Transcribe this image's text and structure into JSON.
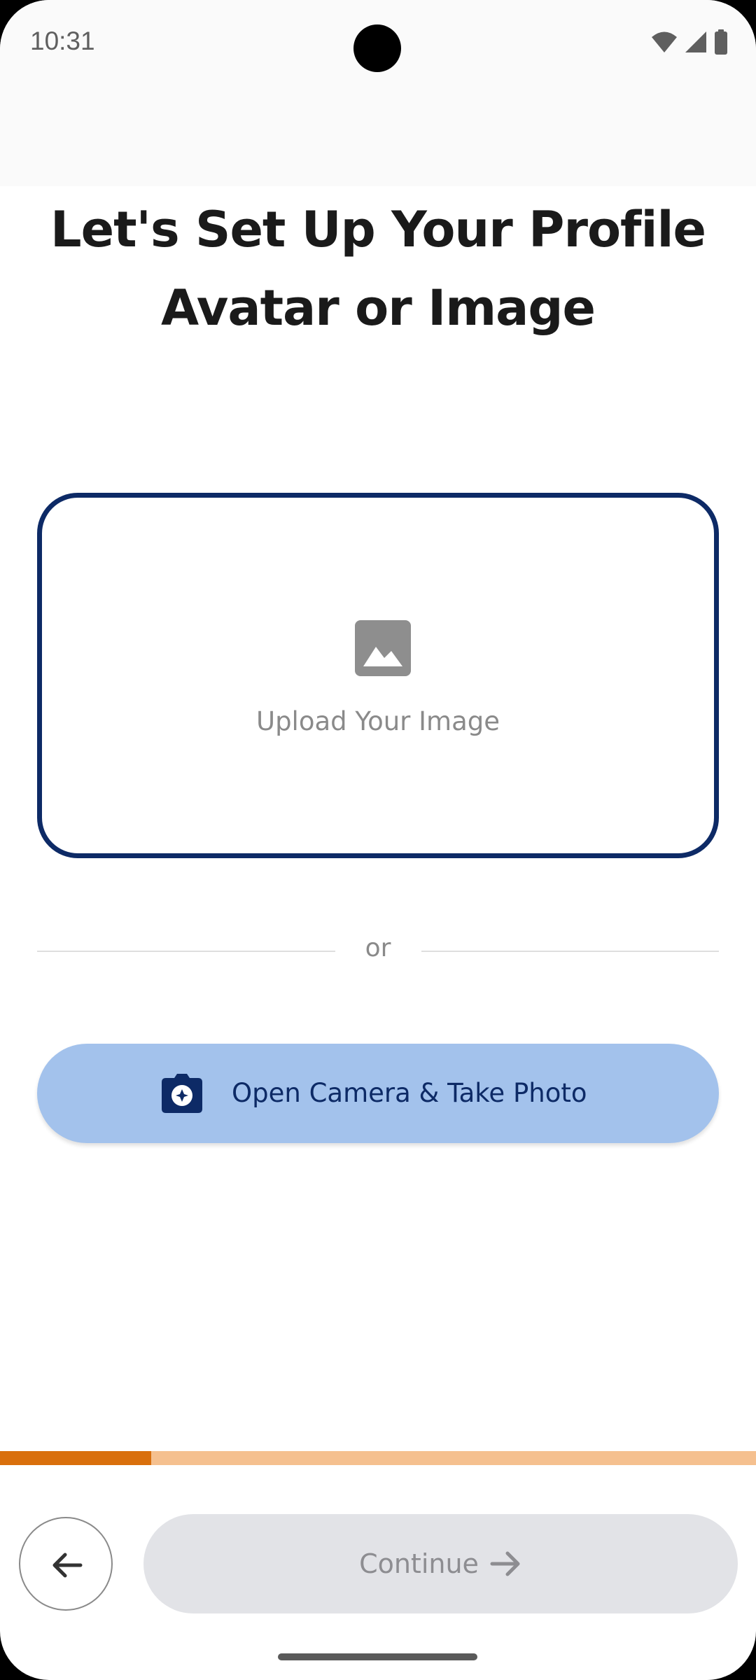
{
  "status_bar": {
    "time": "10:31"
  },
  "screen": {
    "title": "Let's Set Up Your Profile Avatar or Image"
  },
  "upload": {
    "label": "Upload Your Image",
    "icon": "image-icon"
  },
  "divider": {
    "label": "or"
  },
  "camera_button": {
    "label": "Open Camera & Take Photo",
    "icon": "camera-icon"
  },
  "progress": {
    "fraction": 0.2
  },
  "navigation": {
    "back_icon": "arrow-left-icon",
    "continue_label": "Continue",
    "continue_icon": "arrow-right-icon",
    "continue_enabled": false
  },
  "colors": {
    "primary_navy": "#0d2a66",
    "camera_button_bg": "#a3c2ec",
    "progress_fill": "#d96f0c",
    "progress_track": "#f5c08f",
    "disabled_button_bg": "#e2e3e7",
    "disabled_text": "#8d8d91"
  }
}
